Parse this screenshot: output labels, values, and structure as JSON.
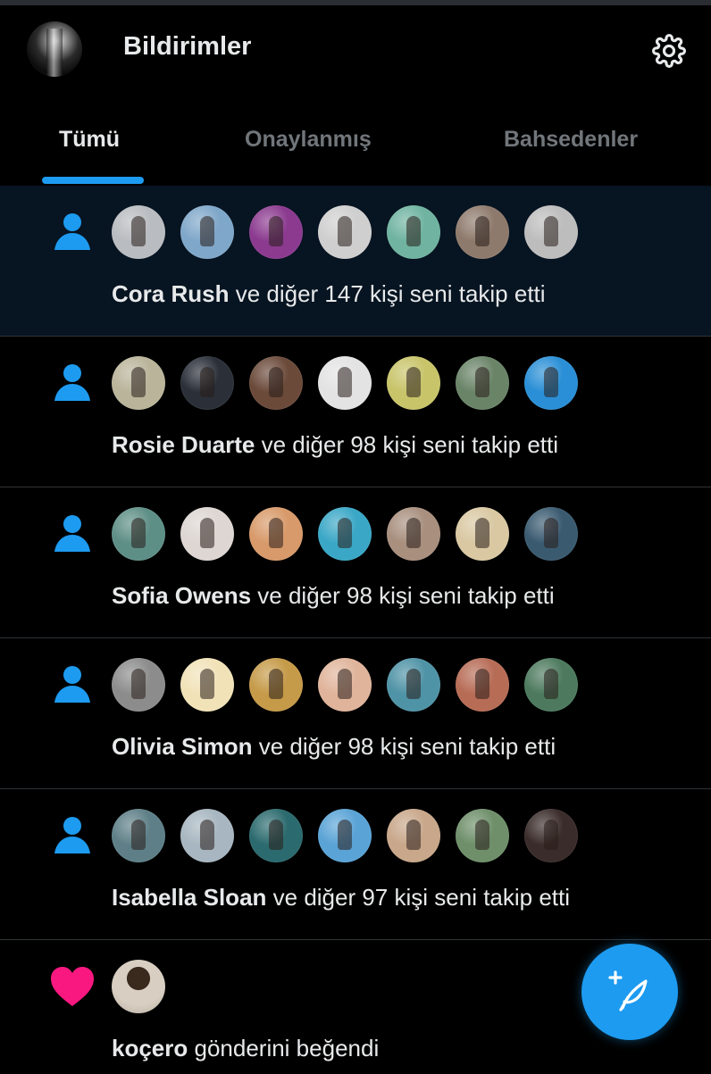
{
  "header": {
    "title": "Bildirimler",
    "avatar_icon": "profile-avatar",
    "settings_icon": "gear-icon"
  },
  "tabs": [
    {
      "label": "Tümü",
      "active": true
    },
    {
      "label": "Onaylanmış",
      "active": false
    },
    {
      "label": "Bahsedenler",
      "active": false
    }
  ],
  "colors": {
    "accent": "#1d9bf0",
    "like": "#f91880",
    "highlight_row": "#071421",
    "text": "#e7e9ea",
    "muted": "#71767b"
  },
  "notifications": [
    {
      "type": "follow",
      "icon": "person-icon",
      "highlighted": true,
      "name": "Cora Rush",
      "action": " ve diğer 147 kişi seni takip etti",
      "avatars": [
        "#b9bcc0",
        "#7fa7c9",
        "#8b3a8f",
        "#cfcfcf",
        "#6fb3a0",
        "#8e7a6c",
        "#bdbdbd"
      ]
    },
    {
      "type": "follow",
      "icon": "person-icon",
      "highlighted": false,
      "name": "Rosie Duarte",
      "action": " ve diğer 98 kişi seni takip etti",
      "avatars": [
        "#b9b49a",
        "#2a2f38",
        "#6b4a3a",
        "#e3e3e3",
        "#c8c46a",
        "#6a8468",
        "#2a8fd6"
      ]
    },
    {
      "type": "follow",
      "icon": "person-icon",
      "highlighted": false,
      "name": "Sofia Owens",
      "action": " ve diğer 98 kişi seni takip etti",
      "avatars": [
        "#5e8f86",
        "#ddd6d2",
        "#d89a6a",
        "#3aa7c6",
        "#a88f7e",
        "#d9c8a2",
        "#3a5a70"
      ]
    },
    {
      "type": "follow",
      "icon": "person-icon",
      "highlighted": false,
      "name": "Olivia Simon",
      "action": " ve diğer 98 kişi seni takip etti",
      "avatars": [
        "#8c8c8c",
        "#f1e2b8",
        "#c59a48",
        "#e0b49b",
        "#4f93a6",
        "#b76c56",
        "#4d7a5e"
      ]
    },
    {
      "type": "follow",
      "icon": "person-icon",
      "highlighted": false,
      "name": "Isabella Sloan",
      "action": " ve diğer 97 kişi seni takip etti",
      "avatars": [
        "#5e7f87",
        "#a7b6c0",
        "#2b6a6e",
        "#5aa3d6",
        "#c8a78a",
        "#6e8f6a",
        "#3a2c2a"
      ]
    }
  ],
  "like": {
    "icon": "heart-icon",
    "name": "koçero",
    "action": " gönderini beğendi"
  },
  "fab": {
    "icon": "compose-feather-plus-icon"
  }
}
